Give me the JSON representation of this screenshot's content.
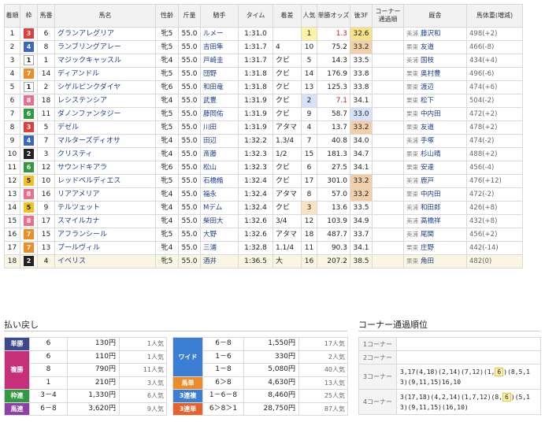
{
  "results": {
    "headers": [
      "着順",
      "枠",
      "馬番",
      "馬名",
      "性齢",
      "斤量",
      "騎手",
      "タイム",
      "着差",
      "人気",
      "単勝オッズ",
      "後3F",
      "コーナー通過順",
      "厩舎",
      "馬体重(増減)"
    ],
    "rows": [
      {
        "rank": "1",
        "waku": "3",
        "num": "6",
        "name": "グランアレグリア",
        "sex": "牝5",
        "kin": "55.0",
        "jockey": "ルメー",
        "time": "1:31.0",
        "margin": "",
        "pop": "1",
        "odds": "1.3",
        "last3f": "32.6",
        "area": "美浦",
        "trainer": "藤沢和",
        "weight": "498(+2)"
      },
      {
        "rank": "2",
        "waku": "4",
        "num": "8",
        "name": "ランブリングアレー",
        "sex": "牝5",
        "kin": "55.0",
        "jockey": "吉田隼",
        "time": "1:31.7",
        "margin": "4",
        "pop": "10",
        "odds": "75.2",
        "last3f": "33.2",
        "area": "栗東",
        "trainer": "友道",
        "weight": "466(-8)"
      },
      {
        "rank": "3",
        "waku": "1",
        "num": "1",
        "name": "マジックキャッスル",
        "sex": "牝4",
        "kin": "55.0",
        "jockey": "戸崎圭",
        "time": "1:31.7",
        "margin": "クビ",
        "pop": "5",
        "odds": "14.3",
        "last3f": "33.5",
        "area": "美浦",
        "trainer": "国枝",
        "weight": "434(+4)"
      },
      {
        "rank": "4",
        "waku": "7",
        "num": "14",
        "name": "ディアンドル",
        "sex": "牝5",
        "kin": "55.0",
        "jockey": "団野",
        "time": "1:31.8",
        "margin": "クビ",
        "pop": "14",
        "odds": "176.9",
        "last3f": "33.8",
        "area": "栗東",
        "trainer": "奥村豊",
        "weight": "496(-6)"
      },
      {
        "rank": "5",
        "waku": "1",
        "num": "2",
        "name": "シゲルピンクダイヤ",
        "sex": "牝6",
        "kin": "55.0",
        "jockey": "和田竜",
        "time": "1:31.8",
        "margin": "クビ",
        "pop": "13",
        "odds": "125.3",
        "last3f": "33.8",
        "area": "栗東",
        "trainer": "渡辺",
        "weight": "474(+6)"
      },
      {
        "rank": "6",
        "waku": "8",
        "num": "18",
        "name": "レシステンシア",
        "sex": "牝4",
        "kin": "55.0",
        "jockey": "武豊",
        "time": "1:31.9",
        "margin": "クビ",
        "pop": "2",
        "odds": "7.1",
        "last3f": "34.1",
        "area": "栗東",
        "trainer": "松下",
        "weight": "504(-2)"
      },
      {
        "rank": "7",
        "waku": "6",
        "num": "11",
        "name": "ダノンファンタジー",
        "sex": "牝5",
        "kin": "55.0",
        "jockey": "藤岡佑",
        "time": "1:31.9",
        "margin": "クビ",
        "pop": "9",
        "odds": "58.7",
        "last3f": "33.0",
        "area": "栗東",
        "trainer": "中内田",
        "weight": "472(+2)"
      },
      {
        "rank": "8",
        "waku": "3",
        "num": "5",
        "name": "デゼル",
        "sex": "牝5",
        "kin": "55.0",
        "jockey": "川田",
        "time": "1:31.9",
        "margin": "アタマ",
        "pop": "4",
        "odds": "13.7",
        "last3f": "33.2",
        "area": "栗東",
        "trainer": "友道",
        "weight": "478(+2)"
      },
      {
        "rank": "9",
        "waku": "4",
        "num": "7",
        "name": "マルターズディオサ",
        "sex": "牝4",
        "kin": "55.0",
        "jockey": "田辺",
        "time": "1:32.2",
        "margin": "1.3/4",
        "pop": "7",
        "odds": "40.8",
        "last3f": "34.0",
        "area": "美浦",
        "trainer": "手塚",
        "weight": "474(-2)"
      },
      {
        "rank": "10",
        "waku": "2",
        "num": "3",
        "name": "クリスティ",
        "sex": "牝4",
        "kin": "55.0",
        "jockey": "斎藤",
        "time": "1:32.3",
        "margin": "1/2",
        "pop": "15",
        "odds": "181.3",
        "last3f": "34.7",
        "area": "栗東",
        "trainer": "杉山晴",
        "weight": "488(+2)"
      },
      {
        "rank": "11",
        "waku": "6",
        "num": "12",
        "name": "サウンドキアラ",
        "sex": "牝6",
        "kin": "55.0",
        "jockey": "松山",
        "time": "1:32.3",
        "margin": "クビ",
        "pop": "6",
        "odds": "27.5",
        "last3f": "34.1",
        "area": "栗東",
        "trainer": "安達",
        "weight": "456(-4)"
      },
      {
        "rank": "12",
        "waku": "5",
        "num": "10",
        "name": "レッドベルディエス",
        "sex": "牝5",
        "kin": "55.0",
        "jockey": "石橋脩",
        "time": "1:32.4",
        "margin": "クビ",
        "pop": "17",
        "odds": "301.0",
        "last3f": "33.2",
        "area": "美浦",
        "trainer": "鹿戸",
        "weight": "476(+12)"
      },
      {
        "rank": "13",
        "waku": "8",
        "num": "16",
        "name": "リアアメリア",
        "sex": "牝4",
        "kin": "55.0",
        "jockey": "福永",
        "time": "1:32.4",
        "margin": "アタマ",
        "pop": "8",
        "odds": "57.0",
        "last3f": "33.2",
        "area": "栗東",
        "trainer": "中内田",
        "weight": "472(-2)"
      },
      {
        "rank": "14",
        "waku": "5",
        "num": "9",
        "name": "テルツェット",
        "sex": "牝4",
        "kin": "55.0",
        "jockey": "Mデム",
        "time": "1:32.4",
        "margin": "クビ",
        "pop": "3",
        "odds": "13.6",
        "last3f": "33.5",
        "area": "美浦",
        "trainer": "和田郎",
        "weight": "426(+8)"
      },
      {
        "rank": "15",
        "waku": "8",
        "num": "17",
        "name": "スマイルカナ",
        "sex": "牝4",
        "kin": "55.0",
        "jockey": "柴田大",
        "time": "1:32.6",
        "margin": "3/4",
        "pop": "12",
        "odds": "103.9",
        "last3f": "34.9",
        "area": "美浦",
        "trainer": "高橋祥",
        "weight": "432(+8)"
      },
      {
        "rank": "16",
        "waku": "7",
        "num": "15",
        "name": "アフランシール",
        "sex": "牝5",
        "kin": "55.0",
        "jockey": "大野",
        "time": "1:32.6",
        "margin": "アタマ",
        "pop": "18",
        "odds": "487.7",
        "last3f": "33.7",
        "area": "美浦",
        "trainer": "尾関",
        "weight": "456(+2)"
      },
      {
        "rank": "17",
        "waku": "7",
        "num": "13",
        "name": "プールヴィル",
        "sex": "牝4",
        "kin": "55.0",
        "jockey": "三浦",
        "time": "1:32.8",
        "margin": "1.1/4",
        "pop": "11",
        "odds": "90.3",
        "last3f": "34.1",
        "area": "栗東",
        "trainer": "庄野",
        "weight": "442(-14)"
      },
      {
        "rank": "18",
        "waku": "2",
        "num": "4",
        "name": "イベリス",
        "sex": "牝5",
        "kin": "55.0",
        "jockey": "酒井",
        "time": "1:36.5",
        "margin": "大",
        "pop": "16",
        "odds": "207.2",
        "last3f": "38.5",
        "area": "栗東",
        "trainer": "角田",
        "weight": "482(0)"
      }
    ]
  },
  "payout": {
    "title": "払い戻し",
    "left": [
      {
        "kind": "単勝",
        "cls": "k-tan",
        "rows": [
          {
            "combo": "6",
            "amount": "130円",
            "pop": "1人気"
          }
        ]
      },
      {
        "kind": "複勝",
        "cls": "k-fuku",
        "rows": [
          {
            "combo": "6",
            "amount": "110円",
            "pop": "1人気"
          },
          {
            "combo": "8",
            "amount": "790円",
            "pop": "11人気"
          },
          {
            "combo": "1",
            "amount": "210円",
            "pop": "3人気"
          }
        ]
      },
      {
        "kind": "枠連",
        "cls": "k-waku",
        "rows": [
          {
            "combo": "3－4",
            "amount": "1,330円",
            "pop": "6人気"
          }
        ]
      },
      {
        "kind": "馬連",
        "cls": "k-uma",
        "rows": [
          {
            "combo": "6－8",
            "amount": "3,620円",
            "pop": "9人気"
          }
        ]
      }
    ],
    "right": [
      {
        "kind": "ワイド",
        "cls": "k-wide",
        "rows": [
          {
            "combo": "6－8",
            "amount": "1,550円",
            "pop": "17人気"
          },
          {
            "combo": "1－6",
            "amount": "330円",
            "pop": "2人気"
          },
          {
            "combo": "1－8",
            "amount": "5,080円",
            "pop": "40人気"
          }
        ]
      },
      {
        "kind": "馬単",
        "cls": "k-uta",
        "rows": [
          {
            "combo": "6＞8",
            "amount": "4,630円",
            "pop": "13人気"
          }
        ]
      },
      {
        "kind": "3連複",
        "cls": "k-sanf",
        "rows": [
          {
            "combo": "1－6－8",
            "amount": "8,460円",
            "pop": "25人気"
          }
        ]
      },
      {
        "kind": "3連単",
        "cls": "k-sant",
        "rows": [
          {
            "combo": "6＞8＞1",
            "amount": "28,750円",
            "pop": "87人気"
          }
        ]
      }
    ]
  },
  "corner": {
    "title": "コーナー通過順位",
    "rows": [
      {
        "label": "1コーナー",
        "pre": "",
        "hl": "",
        "post": ""
      },
      {
        "label": "2コーナー",
        "pre": "",
        "hl": "",
        "post": ""
      },
      {
        "label": "3コーナー",
        "pre": "3,17(4,18)(2,14)(7,12)(1,",
        "hl": "6",
        "post": ")(8,5,13)(9,11,15)16,10"
      },
      {
        "label": "4コーナー",
        "pre": "3(17,18)(4,2,14)(1,7,12)(8,",
        "hl": "6",
        "post": ")(5,13)(9,11,15)(16,10)"
      }
    ]
  }
}
